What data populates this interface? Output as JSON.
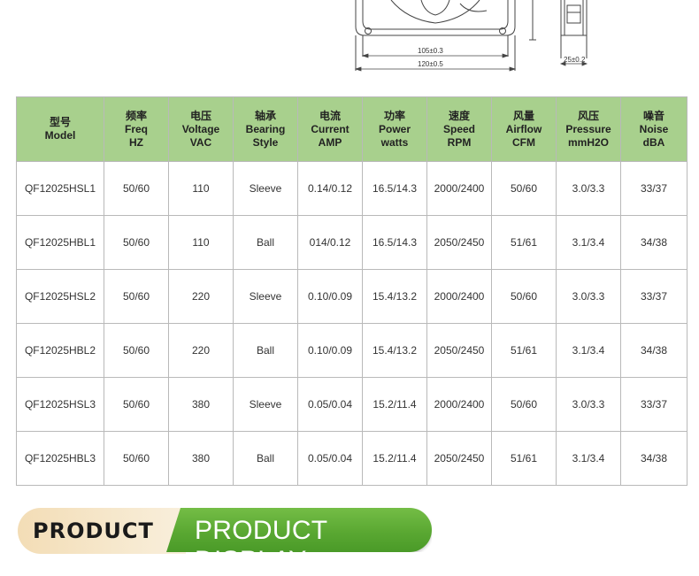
{
  "drawing": {
    "dim_inner": "105±0.3",
    "dim_outer": "120±0.5",
    "dim_depth": "25±0.2"
  },
  "table": {
    "headers": [
      {
        "cn": "型号",
        "en": [
          "Model"
        ]
      },
      {
        "cn": "频率",
        "en": [
          "Freq",
          "HZ"
        ]
      },
      {
        "cn": "电压",
        "en": [
          "Voltage",
          "VAC"
        ]
      },
      {
        "cn": "轴承",
        "en": [
          "Bearing",
          "Style"
        ]
      },
      {
        "cn": "电流",
        "en": [
          "Current",
          "AMP"
        ]
      },
      {
        "cn": "功率",
        "en": [
          "Power",
          "watts"
        ]
      },
      {
        "cn": "速度",
        "en": [
          "Speed",
          "RPM"
        ]
      },
      {
        "cn": "风量",
        "en": [
          "Airflow",
          "CFM"
        ]
      },
      {
        "cn": "风压",
        "en": [
          "Pressure",
          "mmH2O"
        ]
      },
      {
        "cn": "噪音",
        "en": [
          "Noise",
          "dBA"
        ]
      }
    ],
    "rows": [
      [
        "QF12025HSL1",
        "50/60",
        "110",
        "Sleeve",
        "0.14/0.12",
        "16.5/14.3",
        "2000/2400",
        "50/60",
        "3.0/3.3",
        "33/37"
      ],
      [
        "QF12025HBL1",
        "50/60",
        "110",
        "Ball",
        "014/0.12",
        "16.5/14.3",
        "2050/2450",
        "51/61",
        "3.1/3.4",
        "34/38"
      ],
      [
        "QF12025HSL2",
        "50/60",
        "220",
        "Sleeve",
        "0.10/0.09",
        "15.4/13.2",
        "2000/2400",
        "50/60",
        "3.0/3.3",
        "33/37"
      ],
      [
        "QF12025HBL2",
        "50/60",
        "220",
        "Ball",
        "0.10/0.09",
        "15.4/13.2",
        "2050/2450",
        "51/61",
        "3.1/3.4",
        "34/38"
      ],
      [
        "QF12025HSL3",
        "50/60",
        "380",
        "Sleeve",
        "0.05/0.04",
        "15.2/11.4",
        "2000/2400",
        "50/60",
        "3.0/3.3",
        "33/37"
      ],
      [
        "QF12025HBL3",
        "50/60",
        "380",
        "Ball",
        "0.05/0.04",
        "15.2/11.4",
        "2050/2450",
        "51/61",
        "3.1/3.4",
        "34/38"
      ]
    ]
  },
  "banner": {
    "left_text": "PRODUCT",
    "right_text": "PRODUCT DISPLAY",
    "left_color": "#f5e3c3",
    "right_color": "#5aa832"
  }
}
